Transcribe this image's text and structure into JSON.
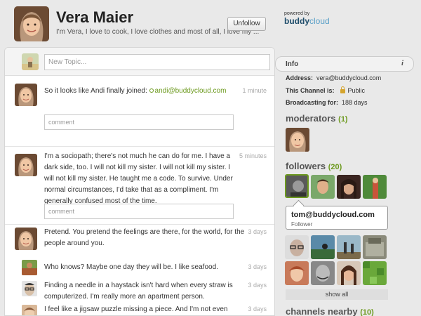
{
  "header": {
    "name": "Vera Maier",
    "description": "I'm Vera, I love to cook, I love clothes and most of all, I love my ...",
    "unfollow_label": "Unfollow",
    "powered_by": "powered by",
    "brand_a": "buddy",
    "brand_b": "cloud"
  },
  "composer": {
    "placeholder": "New Topic..."
  },
  "posts": [
    {
      "text": "So it looks like Andi finally joined:",
      "mention": "andi@buddycloud.com",
      "time": "1 minute",
      "comment_placeholder": "comment"
    },
    {
      "text": "I'm a sociopath; there's not much he can do for me. I have a dark side, too. I will not kill my sister. I will not kill my sister. I will not kill my sister. He taught me a code. To survive. Under normal circumstances, I'd take that as a compliment. I'm generally confused most of the time.",
      "time": "5 minutes",
      "comment_placeholder": "comment"
    },
    {
      "text": "Pretend. You pretend the feelings are there, for the world, for the people around you.",
      "time": "3 days",
      "replies": [
        {
          "text": "Who knows? Maybe one day they will be. I like seafood.",
          "time": "3 days"
        },
        {
          "text": "Finding a needle in a haystack isn't hard when every straw is computerized. I'm really more an apartment person.",
          "time": "3 days"
        },
        {
          "text": "I feel like a jigsaw puzzle missing a piece. And I'm not even sure what",
          "time": "3 days"
        }
      ]
    }
  ],
  "sidebar": {
    "info_label": "Info",
    "info_icon": "i",
    "address_label": "Address:",
    "address_value": "vera@buddycloud.com",
    "channel_label": "This Channel is:",
    "channel_value": "Public",
    "broadcast_label": "Broadcasting for:",
    "broadcast_value": "188 days",
    "moderators_title": "moderators",
    "moderators_count": "(1)",
    "followers_title": "followers",
    "followers_count": "(20)",
    "tooltip_name": "tom@buddycloud.com",
    "tooltip_role": "Follower",
    "show_all_label": "show all",
    "nearby_title": "channels nearby",
    "nearby_count": "(10)"
  },
  "colors": {
    "accent_green": "#6d9a1f",
    "brand_dark": "#1f4d6b",
    "brand_light": "#5aa0c8"
  }
}
